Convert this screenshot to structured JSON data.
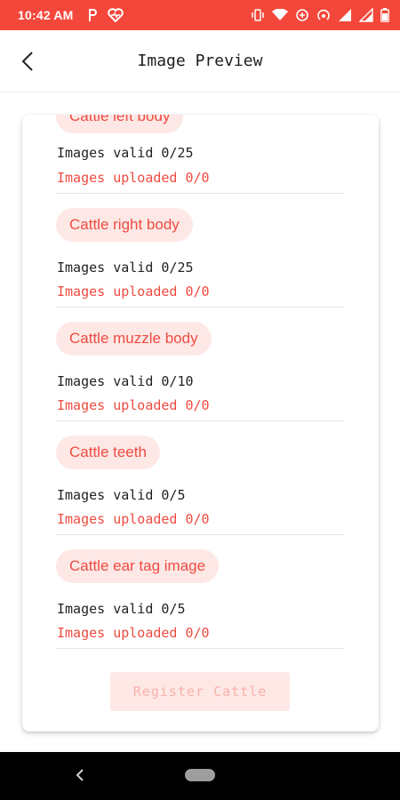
{
  "status_bar": {
    "time": "10:42 AM",
    "left_icons": [
      "parking-icon",
      "heart-pulse-icon"
    ],
    "right_icons": [
      "vibrate-icon",
      "wifi-icon",
      "data-saver-icon",
      "hotspot-icon",
      "signal-icon",
      "signal-icon",
      "battery-icon"
    ],
    "color": "#f4473b"
  },
  "app_bar": {
    "title": "Image Preview",
    "back_icon": "back-arrow-icon"
  },
  "sections": [
    {
      "label": "Cattle left body",
      "valid": "Images valid 0/25",
      "uploaded": "Images uploaded 0/0"
    },
    {
      "label": "Cattle right body",
      "valid": "Images valid 0/25",
      "uploaded": "Images uploaded 0/0"
    },
    {
      "label": "Cattle muzzle body",
      "valid": "Images valid 0/10",
      "uploaded": "Images uploaded 0/0"
    },
    {
      "label": "Cattle teeth",
      "valid": "Images valid 0/5",
      "uploaded": "Images uploaded 0/0"
    },
    {
      "label": "Cattle ear tag image",
      "valid": "Images valid 0/5",
      "uploaded": "Images uploaded 0/0"
    }
  ],
  "register_button": {
    "label": "Register Cattle",
    "enabled": false
  },
  "colors": {
    "accent": "#ef4b41",
    "chip_background": "#fde8e6",
    "text_dark": "#222222"
  },
  "nav_bar": {
    "back_icon": "nav-back-icon",
    "home_icon": "nav-home-pill"
  }
}
